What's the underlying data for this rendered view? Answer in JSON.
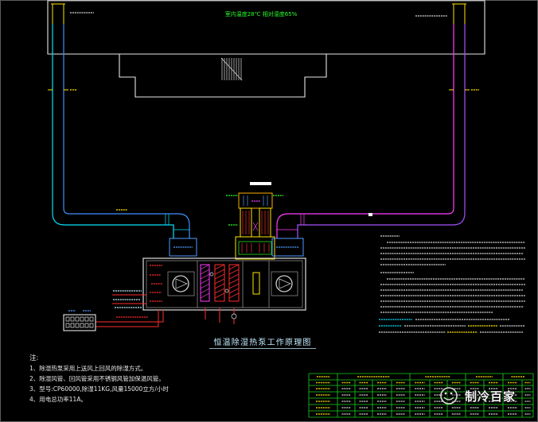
{
  "diagram": {
    "title": "恒温除湿热泵工作原理图",
    "room_condition": "室内温度28℃ 相对湿度65%",
    "notes": {
      "heading": "注:",
      "items": [
        "1、除湿热泵采用上送风上回风的除湿方式。",
        "2、除湿风管、回风管采用不锈钢风管加保温风管。",
        "3、型号:CP60000,除湿11KG,风量15000立方/小时",
        "4、用电总功率11A。"
      ]
    }
  },
  "watermark": {
    "text": "制冷百家",
    "icon": "watermark-logo-icon"
  },
  "colors": {
    "background": "#000000",
    "supply_duct": "#00e1ff",
    "supply_duct_inner": "#3f8fff",
    "return_duct": "#ff3dff",
    "return_duct_inner": "#a653ff",
    "refrigerant_pipe": "#ff2d2d",
    "label_green": "#2bff2b",
    "label_blue": "#4f9cff",
    "highlight_yellow": "#ffe600",
    "damper_orange": "#ffb000",
    "table_green": "#1ed21e",
    "title": "#c2ecff"
  }
}
